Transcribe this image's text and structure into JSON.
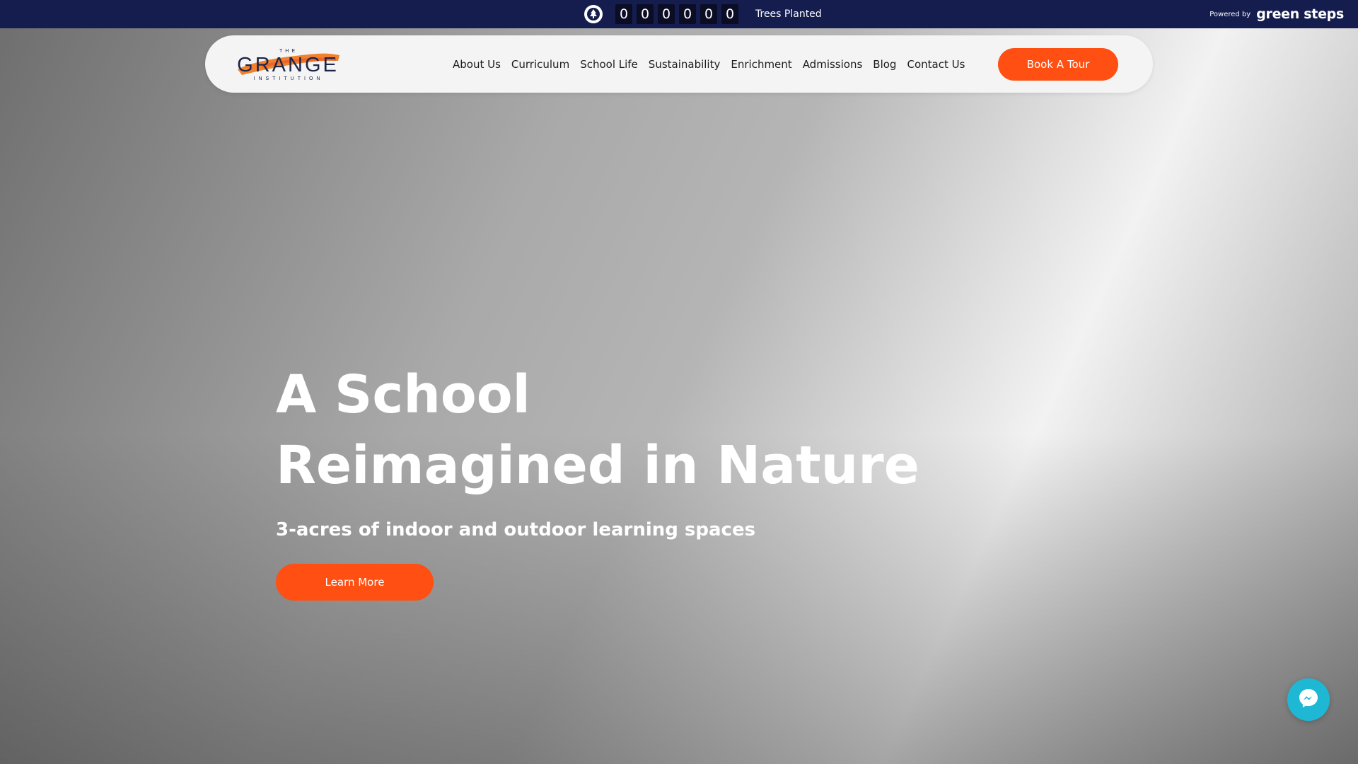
{
  "topbar": {
    "digits": [
      "0",
      "0",
      "0",
      "0",
      "0",
      "0"
    ],
    "trees_label": "Trees Planted",
    "powered_by": "Powered by",
    "powered_brand": "green steps"
  },
  "logo": {
    "the": "THE",
    "name": "GRANGE",
    "sub": "INSTITUTION"
  },
  "nav": {
    "links": [
      "About Us",
      "Curriculum",
      "School Life",
      "Sustainability",
      "Enrichment",
      "Admissions",
      "Blog",
      "Contact Us"
    ],
    "cta": "Book A Tour"
  },
  "hero": {
    "title_line1": "A School",
    "title_line2": "Reimagined in Nature",
    "subtitle": "3-acres of indoor and outdoor learning spaces",
    "cta": "Learn More"
  },
  "colors": {
    "topbar": "#141d4e",
    "accent": "#ff4f12",
    "messenger": "#1fb8d4"
  },
  "icons": [
    "tree-icon",
    "messenger-icon"
  ]
}
